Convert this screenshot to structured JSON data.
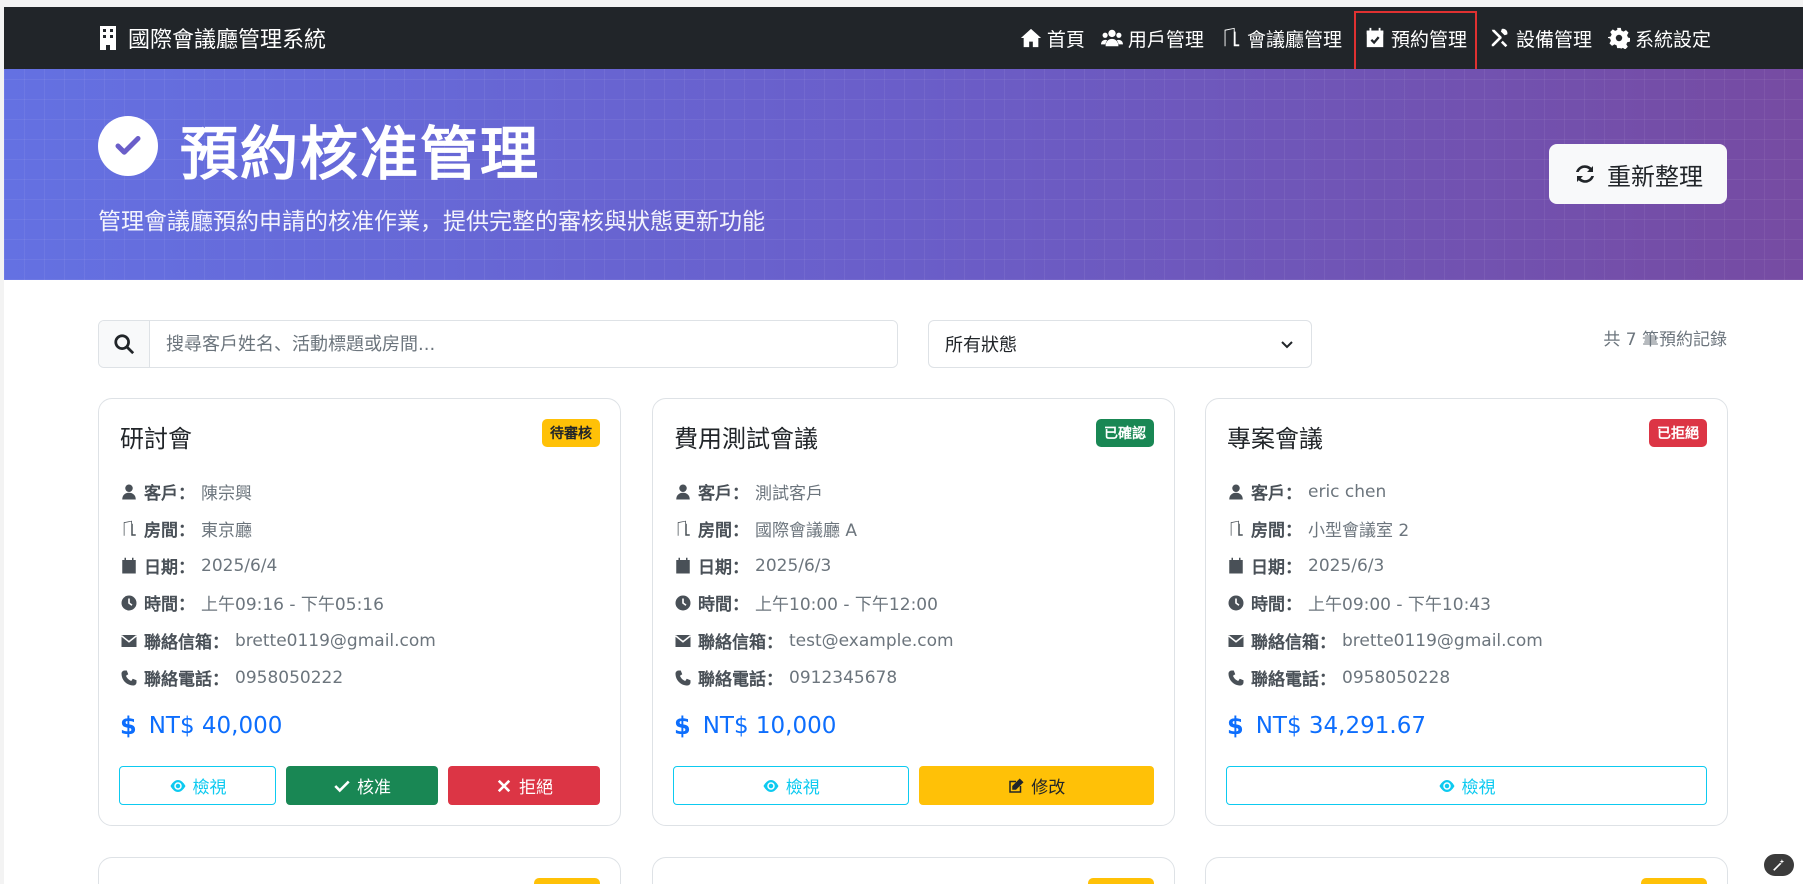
{
  "app": {
    "title": "國際會議廳管理系統"
  },
  "nav": {
    "items": [
      {
        "label": "首頁",
        "icon": "home-icon"
      },
      {
        "label": "用戶管理",
        "icon": "users-icon"
      },
      {
        "label": "會議廳管理",
        "icon": "door-icon"
      },
      {
        "label": "預約管理",
        "icon": "calendar-check-icon",
        "active": true
      },
      {
        "label": "設備管理",
        "icon": "tools-icon"
      },
      {
        "label": "系統設定",
        "icon": "gear-icon"
      }
    ]
  },
  "hero": {
    "title": "預約核准管理",
    "subtitle": "管理會議廳預約申請的核准作業，提供完整的審核與狀態更新功能",
    "refresh_label": "重新整理"
  },
  "filters": {
    "search_placeholder": "搜尋客戶姓名、活動標題或房間...",
    "status_value": "所有狀態",
    "record_count": "共 7 筆預約記錄"
  },
  "labels": {
    "customer": "客戶：",
    "room": "房間：",
    "date": "日期：",
    "time": "時間：",
    "email": "聯絡信箱：",
    "phone": "聯絡電話：",
    "view": "檢視",
    "approve": "核准",
    "reject": "拒絕",
    "edit": "修改"
  },
  "colors": {
    "pending": "#ffc107",
    "confirmed": "#198754",
    "rejected": "#dc3545",
    "accent": "#0d6efd"
  },
  "bookings": [
    {
      "title": "研討會",
      "status": "待審核",
      "customer": "陳宗興",
      "room": "東京廳",
      "date": "2025/6/4",
      "time": "上午09:16 - 下午05:16",
      "email": "brette0119@gmail.com",
      "phone": "0958050222",
      "price": "NT$ 40,000"
    },
    {
      "title": "費用測試會議",
      "status": "已確認",
      "customer": "測試客戶",
      "room": "國際會議廳 A",
      "date": "2025/6/3",
      "time": "上午10:00 - 下午12:00",
      "email": "test@example.com",
      "phone": "0912345678",
      "price": "NT$ 10,000"
    },
    {
      "title": "專案會議",
      "status": "已拒絕",
      "customer": "eric chen",
      "room": "小型會議室 2",
      "date": "2025/6/3",
      "time": "上午09:00 - 下午10:43",
      "email": "brette0119@gmail.com",
      "phone": "0958050228",
      "price": "NT$ 34,291.67"
    }
  ]
}
